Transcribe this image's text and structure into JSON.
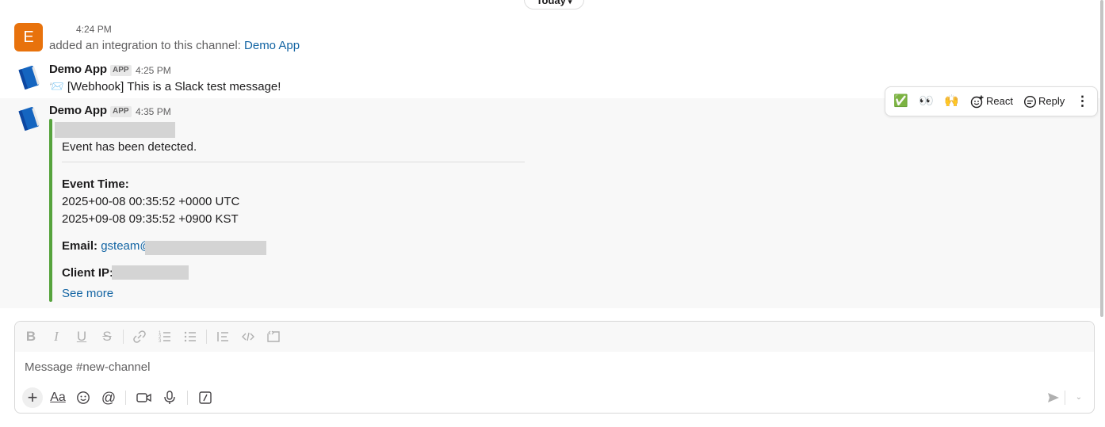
{
  "divider": {
    "label": "Today",
    "chevron": "chevron-down-icon"
  },
  "messages": [
    {
      "avatar_letter": "E",
      "avatar_color": "#e8720c",
      "time": "4:24 PM",
      "text_prefix": "added an integration to this channel: ",
      "text_link": "Demo App"
    },
    {
      "sender": "Demo App",
      "badge": "APP",
      "time": "4:25 PM",
      "emoji": "📨",
      "text": "[Webhook] This is a Slack test message!"
    },
    {
      "sender": "Demo App",
      "badge": "APP",
      "time": "4:35 PM",
      "attachment": {
        "accent_color": "#56a33d",
        "intro": "Event has been detected.",
        "event_time_label": "Event Time:",
        "event_time_utc": "2025+00-08 00:35:52 +0000 UTC",
        "event_time_kst": "2025+09-08 09:35:52 +0900 KST",
        "email_label": "Email:",
        "email_value": "gsteam@",
        "client_ip_label": "Client IP:",
        "see_more": "See more"
      }
    }
  ],
  "hover_toolbar": {
    "reactions": [
      "✅",
      "👀",
      "🙌"
    ],
    "react_label": "React",
    "reply_label": "Reply",
    "more_icon": "more-vertical-icon"
  },
  "composer": {
    "placeholder": "Message #new-channel",
    "format_tools": [
      "bold-icon",
      "italic-icon",
      "underline-icon",
      "strikethrough-icon",
      "link-icon",
      "ordered-list-icon",
      "bulleted-list-icon",
      "blockquote-icon",
      "code-icon",
      "code-block-icon"
    ],
    "aa_label": "Aa"
  }
}
